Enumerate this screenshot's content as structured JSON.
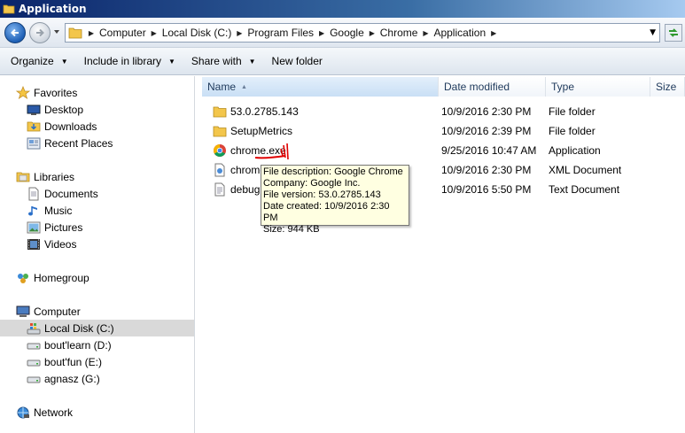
{
  "window": {
    "title": "Application"
  },
  "address": {
    "crumbs": [
      "Computer",
      "Local Disk (C:)",
      "Program Files",
      "Google",
      "Chrome",
      "Application"
    ]
  },
  "toolbar": {
    "organize": "Organize",
    "include": "Include in library",
    "share": "Share with",
    "newfolder": "New folder"
  },
  "nav": {
    "favorites": "Favorites",
    "desktop": "Desktop",
    "downloads": "Downloads",
    "recent": "Recent Places",
    "libraries": "Libraries",
    "documents": "Documents",
    "music": "Music",
    "pictures": "Pictures",
    "videos": "Videos",
    "homegroup": "Homegroup",
    "computer": "Computer",
    "drive_c": "Local Disk (C:)",
    "drive_d": "bout'learn (D:)",
    "drive_e": "bout'fun (E:)",
    "drive_g": "agnasz (G:)",
    "network": "Network"
  },
  "columns": {
    "name": "Name",
    "date": "Date modified",
    "type": "Type",
    "size": "Size"
  },
  "files": [
    {
      "name": "53.0.2785.143",
      "date": "10/9/2016 2:30 PM",
      "type": "File folder",
      "icon": "folder-icon"
    },
    {
      "name": "SetupMetrics",
      "date": "10/9/2016 2:39 PM",
      "type": "File folder",
      "icon": "folder-icon"
    },
    {
      "name": "chrome.exe",
      "date": "9/25/2016 10:47 AM",
      "type": "Application",
      "icon": "chrome-icon"
    },
    {
      "name": "chrome",
      "date": "10/9/2016 2:30 PM",
      "type": "XML Document",
      "icon": "xml-file-icon"
    },
    {
      "name": "debug",
      "date": "10/9/2016 5:50 PM",
      "type": "Text Document",
      "icon": "text-file-icon"
    }
  ],
  "tooltip": {
    "line1": "File description: Google Chrome",
    "line2": "Company: Google Inc.",
    "line3": "File version: 53.0.2785.143",
    "line4": "Date created: 10/9/2016 2:30 PM",
    "line5": "Size: 944 KB"
  },
  "colors": {
    "selected_bg": "#d9d9d9",
    "tooltip_bg": "#ffffe1",
    "header_text": "#1e395b",
    "annotation": "#e00000"
  }
}
